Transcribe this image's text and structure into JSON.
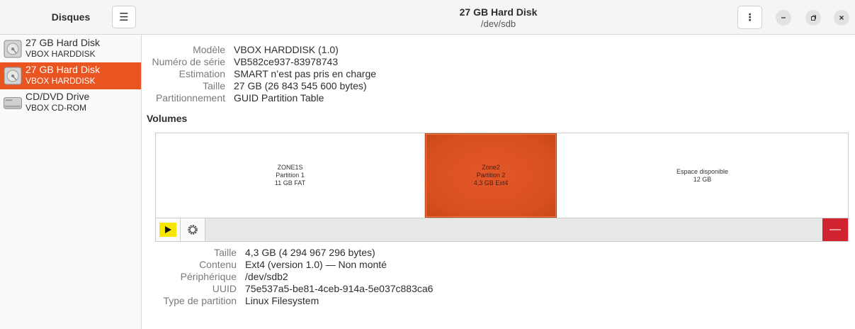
{
  "sidebar": {
    "title": "Disques",
    "drives": [
      {
        "name": "27 GB Hard Disk",
        "model": "VBOX HARDDISK",
        "icon": "hard-disk-icon",
        "selected": false
      },
      {
        "name": "27 GB Hard Disk",
        "model": "VBOX HARDDISK",
        "icon": "hard-disk-icon",
        "selected": true
      },
      {
        "name": "CD/DVD Drive",
        "model": "VBOX CD-ROM",
        "icon": "optical-drive-icon",
        "selected": false
      }
    ]
  },
  "header": {
    "title": "27 GB Hard Disk",
    "subtitle": "/dev/sdb"
  },
  "disk_info": [
    {
      "label": "Modèle",
      "value": "VBOX HARDDISK (1.0)"
    },
    {
      "label": "Numéro de série",
      "value": "VB582ce937-83978743"
    },
    {
      "label": "Estimation",
      "value": "SMART n’est pas pris en charge"
    },
    {
      "label": "Taille",
      "value": "27 GB (26 843 545 600 bytes)"
    },
    {
      "label": "Partitionnement",
      "value": "GUID Partition Table"
    }
  ],
  "volumes": {
    "title": "Volumes",
    "items": [
      {
        "name": "ZONE1S",
        "sub": "Partition 1",
        "size": "11 GB FAT",
        "selected": false
      },
      {
        "name": "Zone2",
        "sub": "Partition 2",
        "size": "4,3 GB Ext4",
        "selected": true
      },
      {
        "name": "Espace disponible",
        "sub": "12 GB",
        "size": "",
        "selected": false
      }
    ]
  },
  "partition_info": [
    {
      "label": "Taille",
      "value": "4,3 GB (4 294 967 296 bytes)"
    },
    {
      "label": "Contenu",
      "value": "Ext4 (version 1.0) — Non monté"
    },
    {
      "label": "Périphérique",
      "value": "/dev/sdb2"
    },
    {
      "label": "UUID",
      "value": "75e537a5-be81-4ceb-914a-5e037c883ca6"
    },
    {
      "label": "Type de partition",
      "value": "Linux Filesystem"
    }
  ],
  "colors": {
    "accent": "#e95420",
    "delete": "#d0222f",
    "highlight": "#f7e600"
  }
}
